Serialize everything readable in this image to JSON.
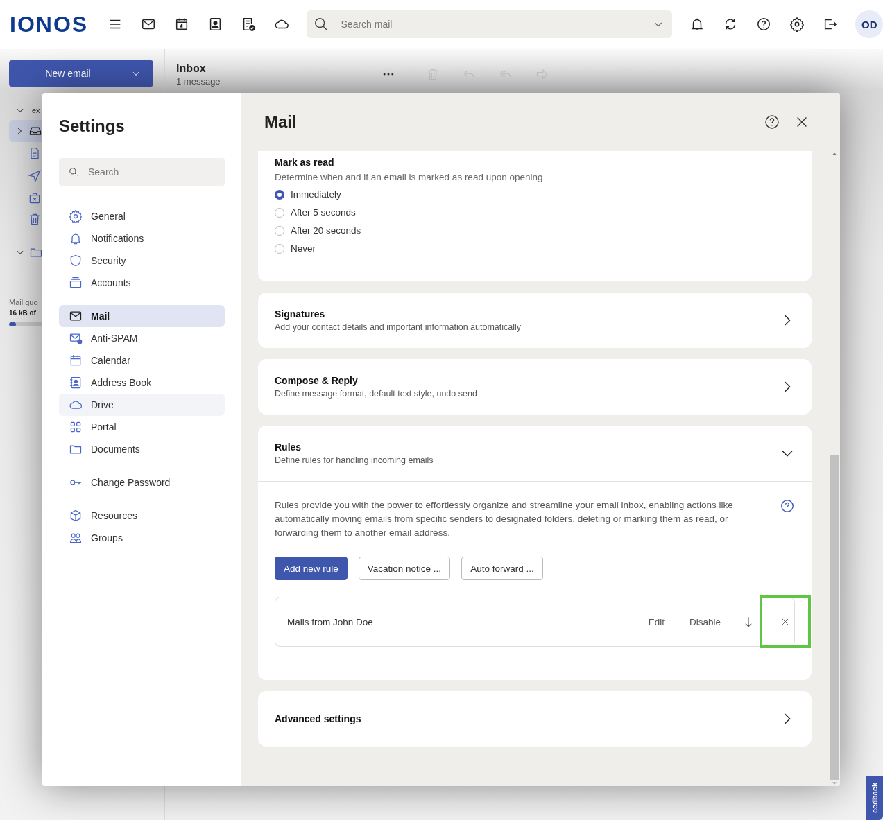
{
  "topbar": {
    "logo": "IONOS",
    "search_placeholder": "Search mail",
    "avatar": "OD"
  },
  "app": {
    "new_email": "New email",
    "folder_title": "Inbox",
    "folder_count": "1 message",
    "account": "ex",
    "quota_label": "Mail quo",
    "quota_value": "16 kB of",
    "quota": {
      "level": 0.2
    }
  },
  "settings": {
    "title": "Settings",
    "search_placeholder": "Search",
    "nav_groups": [
      [
        {
          "label": "General",
          "selected": false,
          "hovered": false
        },
        {
          "label": "Notifications",
          "selected": false,
          "hovered": false
        },
        {
          "label": "Security",
          "selected": false,
          "hovered": false
        },
        {
          "label": "Accounts",
          "selected": false,
          "hovered": false
        }
      ],
      [
        {
          "label": "Mail",
          "selected": true,
          "hovered": false
        },
        {
          "label": "Anti-SPAM",
          "selected": false,
          "hovered": false
        },
        {
          "label": "Calendar",
          "selected": false,
          "hovered": false
        },
        {
          "label": "Address Book",
          "selected": false,
          "hovered": false
        },
        {
          "label": "Drive",
          "selected": false,
          "hovered": true
        },
        {
          "label": "Portal",
          "selected": false,
          "hovered": false
        },
        {
          "label": "Documents",
          "selected": false,
          "hovered": false
        }
      ],
      [
        {
          "label": "Change Password",
          "selected": false,
          "hovered": false
        }
      ],
      [
        {
          "label": "Resources",
          "selected": false,
          "hovered": false
        },
        {
          "label": "Groups",
          "selected": false,
          "hovered": false
        }
      ]
    ]
  },
  "panel": {
    "title": "Mail",
    "sections": [
      {
        "kind": "radio",
        "title": "Mark as read",
        "description": "Determine when and if an email is marked as read upon opening",
        "options": [
          {
            "label": "Immediately",
            "selected": true
          },
          {
            "label": "After 5 seconds",
            "selected": false
          },
          {
            "label": "After 20 seconds",
            "selected": false
          },
          {
            "label": "Never",
            "selected": false
          }
        ]
      },
      {
        "kind": "collapsible",
        "title": "Signatures",
        "description": "Add your contact details and important information automatically",
        "expanded": false
      },
      {
        "kind": "collapsible",
        "title": "Compose & Reply",
        "description": "Define message format, default text style, undo send",
        "expanded": false
      },
      {
        "kind": "collapsible",
        "title": "Rules",
        "description": "Define rules for handling incoming emails",
        "expanded": true,
        "body": "Rules provide you with the power to effortlessly organize and streamline your email inbox, enabling actions like automatically moving emails from specific senders to designated folders, deleting or marking them as read, or forwarding them to another email address.",
        "buttons": [
          {
            "label": "Add new rule",
            "primary": true
          },
          {
            "label": "Vacation notice ...",
            "primary": false
          },
          {
            "label": "Auto forward ...",
            "primary": false
          }
        ],
        "rules": [
          {
            "name": "Mails from John Doe",
            "actions": [
              "Edit",
              "Disable"
            ],
            "delete_highlighted": true
          }
        ]
      },
      {
        "kind": "collapsible",
        "title": "Advanced settings",
        "expanded": false
      }
    ]
  },
  "feedback": "eedback"
}
